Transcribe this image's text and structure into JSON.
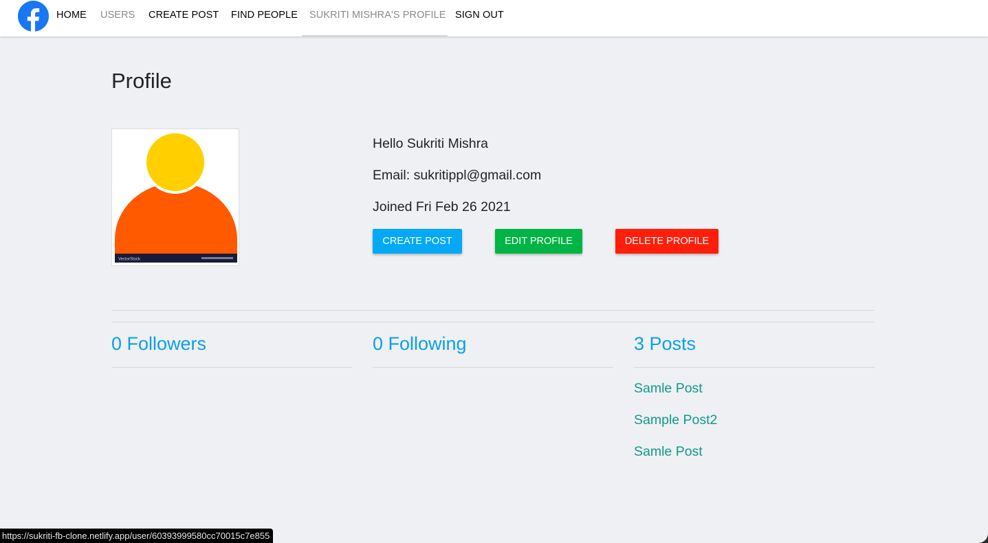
{
  "nav": {
    "items": [
      {
        "label": "HOME"
      },
      {
        "label": "USERS"
      },
      {
        "label": "CREATE POST"
      },
      {
        "label": "FIND PEOPLE"
      },
      {
        "label": "SUKRITI MISHRA'S PROFILE"
      },
      {
        "label": "SIGN OUT"
      }
    ],
    "logo_icon": "facebook-logo-icon",
    "brand_color": "#1877f2"
  },
  "profile": {
    "title": "Profile",
    "greeting": "Hello Sukriti Mishra",
    "email": "Email: sukritippl@gmail.com",
    "joined": "Joined Fri Feb 26 2021",
    "avatar_watermark": "VectorStock"
  },
  "actions": {
    "create_post": "CREATE POST",
    "edit_profile": "EDIT PROFILE",
    "delete_profile": "DELETE PROFILE",
    "colors": {
      "create": "#03a9f4",
      "edit": "#00b545",
      "delete": "#ff1e0a"
    }
  },
  "stats": {
    "followers": "0 Followers",
    "following": "0 Following",
    "posts": "3 Posts"
  },
  "posts": [
    {
      "title": "Samle Post"
    },
    {
      "title": "Sample Post2"
    },
    {
      "title": "Samle Post"
    }
  ],
  "status_bar": {
    "url": "https://sukriti-fb-clone.netlify.app/user/60393999580cc70015c7e855"
  }
}
